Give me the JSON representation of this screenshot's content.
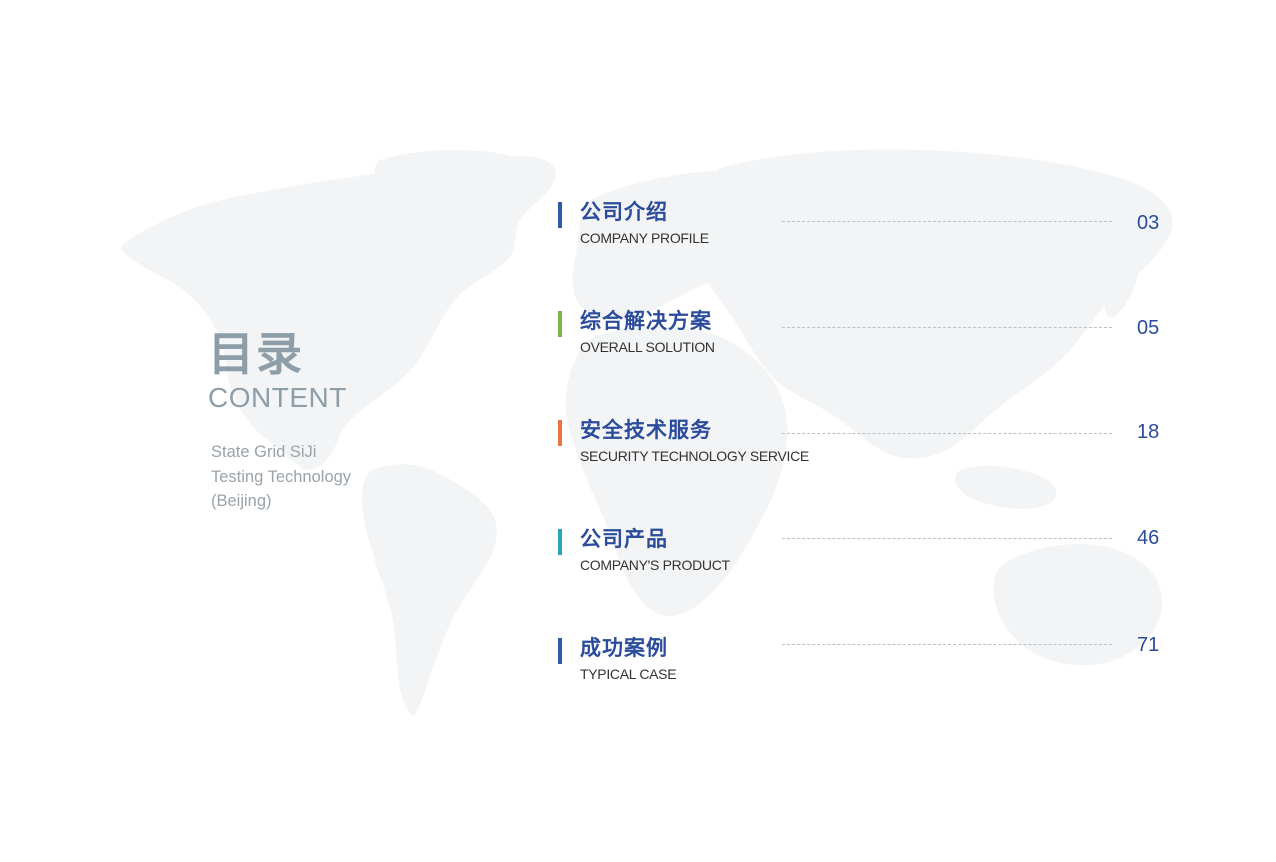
{
  "heading": {
    "title_cn": "目录",
    "title_en": "CONTENT"
  },
  "company": {
    "lines": [
      "State Grid SiJi",
      "Testing Technology",
      "(Beijing)"
    ]
  },
  "toc": [
    {
      "title_cn": "公司介绍",
      "title_en": "COMPANY PROFILE",
      "page": "03",
      "accent": "#2f5aa8"
    },
    {
      "title_cn": "综合解决方案",
      "title_en": "OVERALL SOLUTION",
      "page": "05",
      "accent": "#7ab648"
    },
    {
      "title_cn": "安全技术服务",
      "title_en": "SECURITY TECHNOLOGY SERVICE",
      "page": "18",
      "accent": "#e8743b"
    },
    {
      "title_cn": "公司产品",
      "title_en": "COMPANY'S PRODUCT",
      "page": "46",
      "accent": "#2ea3b7"
    },
    {
      "title_cn": "成功案例",
      "title_en": "TYPICAL CASE",
      "page": "71",
      "accent": "#2f5aa8"
    }
  ],
  "colors": {
    "primary_blue": "#2b4c9c",
    "heading_gray": "#8d9ea8",
    "map_fill": "#f3f4f5"
  },
  "background_icon": "world-map"
}
